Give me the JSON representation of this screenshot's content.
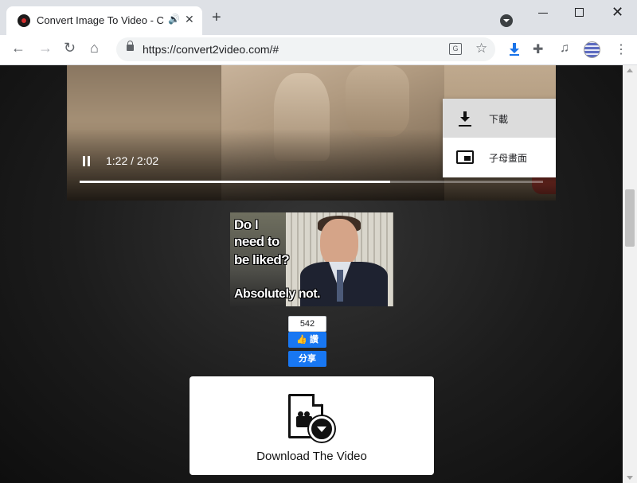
{
  "browser": {
    "tab": {
      "title": "Convert Image To Video - C",
      "audio_icon": "speaker-icon",
      "close_label": "✕"
    },
    "new_tab_label": "+",
    "url": "https://convert2video.com/#",
    "window_controls": {
      "close_label": "✕"
    },
    "translate_label": "G"
  },
  "video": {
    "time": "1:22 / 2:02",
    "progress_fraction": 0.67,
    "context_menu": {
      "items": [
        {
          "label": "下載",
          "icon": "download-icon",
          "hovered": true
        },
        {
          "label": "子母畫面",
          "icon": "picture-in-picture-icon",
          "hovered": false
        }
      ]
    }
  },
  "meme": {
    "lines": [
      "Do I",
      "need to",
      "be liked?",
      "Absolutely not."
    ]
  },
  "facebook": {
    "count": "542",
    "like_label": "👍 讚",
    "share_label": "分享",
    "color": "#1877f2"
  },
  "download_card": {
    "label": "Download The Video",
    "icon": "download-video-icon"
  }
}
